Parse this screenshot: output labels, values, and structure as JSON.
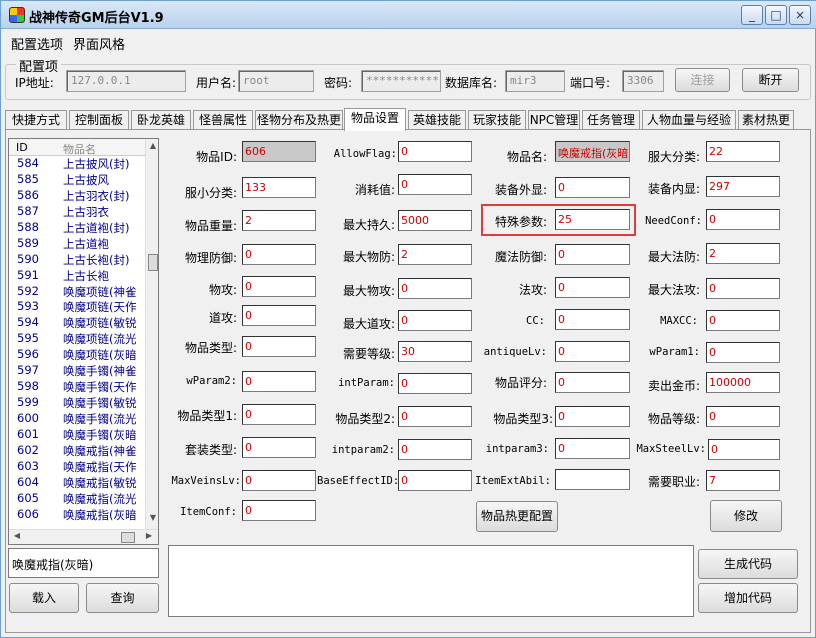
{
  "window": {
    "title": "战神传奇GM后台V1.9",
    "minimize": "_",
    "maximize": "□",
    "close": "×"
  },
  "menu": [
    "配置选项",
    "界面风格"
  ],
  "config": {
    "group_title": "配置项",
    "ip_label": "IP地址:",
    "ip_value": "127.0.0.1",
    "user_label": "用户名:",
    "user_value": "root",
    "pwd_label": "密码:",
    "pwd_value": "***********",
    "db_label": "数据库名:",
    "db_value": "mir3",
    "port_label": "端口号:",
    "port_value": "3306",
    "connect_label": "连接",
    "disconnect_label": "断开"
  },
  "tabs": [
    "快捷方式",
    "控制面板",
    "卧龙英雄",
    "怪兽属性",
    "怪物分布及热更",
    "物品设置",
    "英雄技能",
    "玩家技能",
    "NPC管理",
    "任务管理",
    "人物血量与经验",
    "素材热更"
  ],
  "active_tab": "物品设置",
  "list": {
    "col_id": "ID",
    "col_name": "物品名",
    "rows": [
      {
        "id": "584",
        "name": "上古披风(封)"
      },
      {
        "id": "585",
        "name": "上古披风"
      },
      {
        "id": "586",
        "name": "上古羽衣(封)"
      },
      {
        "id": "587",
        "name": "上古羽衣"
      },
      {
        "id": "588",
        "name": "上古道袍(封)"
      },
      {
        "id": "589",
        "name": "上古道袍"
      },
      {
        "id": "590",
        "name": "上古长袍(封)"
      },
      {
        "id": "591",
        "name": "上古长袍"
      },
      {
        "id": "592",
        "name": "唤魔项链(神雀"
      },
      {
        "id": "593",
        "name": "唤魔项链(天作"
      },
      {
        "id": "594",
        "name": "唤魔项链(敏锐"
      },
      {
        "id": "595",
        "name": "唤魔项链(流光"
      },
      {
        "id": "596",
        "name": "唤魔项链(灰暗"
      },
      {
        "id": "597",
        "name": "唤魔手镯(神雀"
      },
      {
        "id": "598",
        "name": "唤魔手镯(天作"
      },
      {
        "id": "599",
        "name": "唤魔手镯(敏锐"
      },
      {
        "id": "600",
        "name": "唤魔手镯(流光"
      },
      {
        "id": "601",
        "name": "唤魔手镯(灰暗"
      },
      {
        "id": "602",
        "name": "唤魔戒指(神雀"
      },
      {
        "id": "603",
        "name": "唤魔戒指(天作"
      },
      {
        "id": "604",
        "name": "唤魔戒指(敏锐"
      },
      {
        "id": "605",
        "name": "唤魔戒指(流光"
      },
      {
        "id": "606",
        "name": "唤魔戒指(灰暗"
      }
    ]
  },
  "selected_name": "唤魔戒指(灰暗)",
  "buttons": {
    "load": "载入",
    "query": "查询",
    "hot_update": "物品热更配置",
    "modify": "修改",
    "generate": "生成代码",
    "add": "增加代码"
  },
  "fields": {
    "item_id": {
      "label": "物品ID:",
      "value": "606"
    },
    "allow_flag": {
      "label": "AllowFlag:",
      "value": "0"
    },
    "item_name": {
      "label": "物品名:",
      "value": "唤魔戒指(灰暗"
    },
    "big_cat": {
      "label": "服大分类:",
      "value": "22"
    },
    "small_cat": {
      "label": "服小分类:",
      "value": "133"
    },
    "consume": {
      "label": "消耗值:",
      "value": "0"
    },
    "equip_look": {
      "label": "装备外显:",
      "value": "0"
    },
    "equip_inner": {
      "label": "装备内显:",
      "value": "297"
    },
    "weight": {
      "label": "物品重量:",
      "value": "2"
    },
    "max_dura": {
      "label": "最大持久:",
      "value": "5000"
    },
    "special": {
      "label": "特殊参数:",
      "value": "25"
    },
    "need_conf": {
      "label": "NeedConf:",
      "value": "0"
    },
    "pdef": {
      "label": "物理防御:",
      "value": "0"
    },
    "max_pdef": {
      "label": "最大物防:",
      "value": "2"
    },
    "mdef": {
      "label": "魔法防御:",
      "value": "0"
    },
    "max_mdef": {
      "label": "最大法防:",
      "value": "2"
    },
    "patk": {
      "label": "物攻:",
      "value": "0"
    },
    "max_patk": {
      "label": "最大物攻:",
      "value": "0"
    },
    "matk": {
      "label": "法攻:",
      "value": "0"
    },
    "max_matk": {
      "label": "最大法攻:",
      "value": "0"
    },
    "datk": {
      "label": "道攻:",
      "value": "0"
    },
    "max_datk": {
      "label": "最大道攻:",
      "value": "0"
    },
    "cc": {
      "label": "CC:",
      "value": "0"
    },
    "maxcc": {
      "label": "MAXCC:",
      "value": "0"
    },
    "item_type": {
      "label": "物品类型:",
      "value": "0"
    },
    "need_level": {
      "label": "需要等级:",
      "value": "30"
    },
    "antique": {
      "label": "antiqueLv:",
      "value": "0"
    },
    "wparam1": {
      "label": "wParam1:",
      "value": "0"
    },
    "wparam2": {
      "label": "wParam2:",
      "value": "0"
    },
    "intparam": {
      "label": "intParam:",
      "value": "0"
    },
    "score": {
      "label": "物品评分:",
      "value": "0"
    },
    "sell_gold": {
      "label": "卖出金币:",
      "value": "100000"
    },
    "type1": {
      "label": "物品类型1:",
      "value": "0"
    },
    "type2": {
      "label": "物品类型2:",
      "value": "0"
    },
    "type3": {
      "label": "物品类型3:",
      "value": "0"
    },
    "item_level": {
      "label": "物品等级:",
      "value": "0"
    },
    "suit_type": {
      "label": "套装类型:",
      "value": "0"
    },
    "intparam2": {
      "label": "intparam2:",
      "value": "0"
    },
    "intparam3": {
      "label": "intparam3:",
      "value": "0"
    },
    "max_steel": {
      "label": "MaxSteelLv:",
      "value": "0"
    },
    "max_veins": {
      "label": "MaxVeinsLv:",
      "value": "0"
    },
    "base_effect": {
      "label": "BaseEffectID:",
      "value": "0"
    },
    "ext_abil": {
      "label": "ItemExtAbil:",
      "value": ""
    },
    "need_job": {
      "label": "需要职业:",
      "value": "7"
    },
    "item_conf": {
      "label": "ItemConf:",
      "value": "0"
    }
  }
}
